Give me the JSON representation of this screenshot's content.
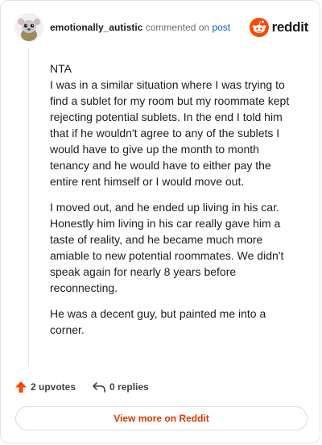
{
  "header": {
    "username": "emotionally_autistic",
    "action_text": "commented on",
    "post_link": "post",
    "brand_name": "reddit"
  },
  "comment": {
    "paragraphs": [
      "NTA\nI was in a similar situation where I was trying to find a sublet for my room but my roommate kept rejecting potential sublets. In the end I told him that if he wouldn't agree to any of the sublets I would have to give up the month to month tenancy and he would have to either pay the entire rent himself or I would move out.",
      "I moved out, and he ended up living in his car. Honestly him living in his car really gave him a taste of reality, and he became much more amiable to new potential roommates. We didn't speak again for nearly 8 years before reconnecting.",
      "He was a decent guy, but painted me into a corner."
    ]
  },
  "actions": {
    "upvotes_label": "2 upvotes",
    "replies_label": "0 replies"
  },
  "footer": {
    "view_more_label": "View more on Reddit"
  },
  "colors": {
    "brand_orange": "#ff4500",
    "link_blue": "#0a5bd6",
    "view_more_text": "#d93900"
  },
  "icons": {
    "avatar": "snoo-avatar-icon",
    "brand": "reddit-logo-icon",
    "upvote": "upvote-arrow-icon",
    "reply": "reply-arrow-icon"
  }
}
